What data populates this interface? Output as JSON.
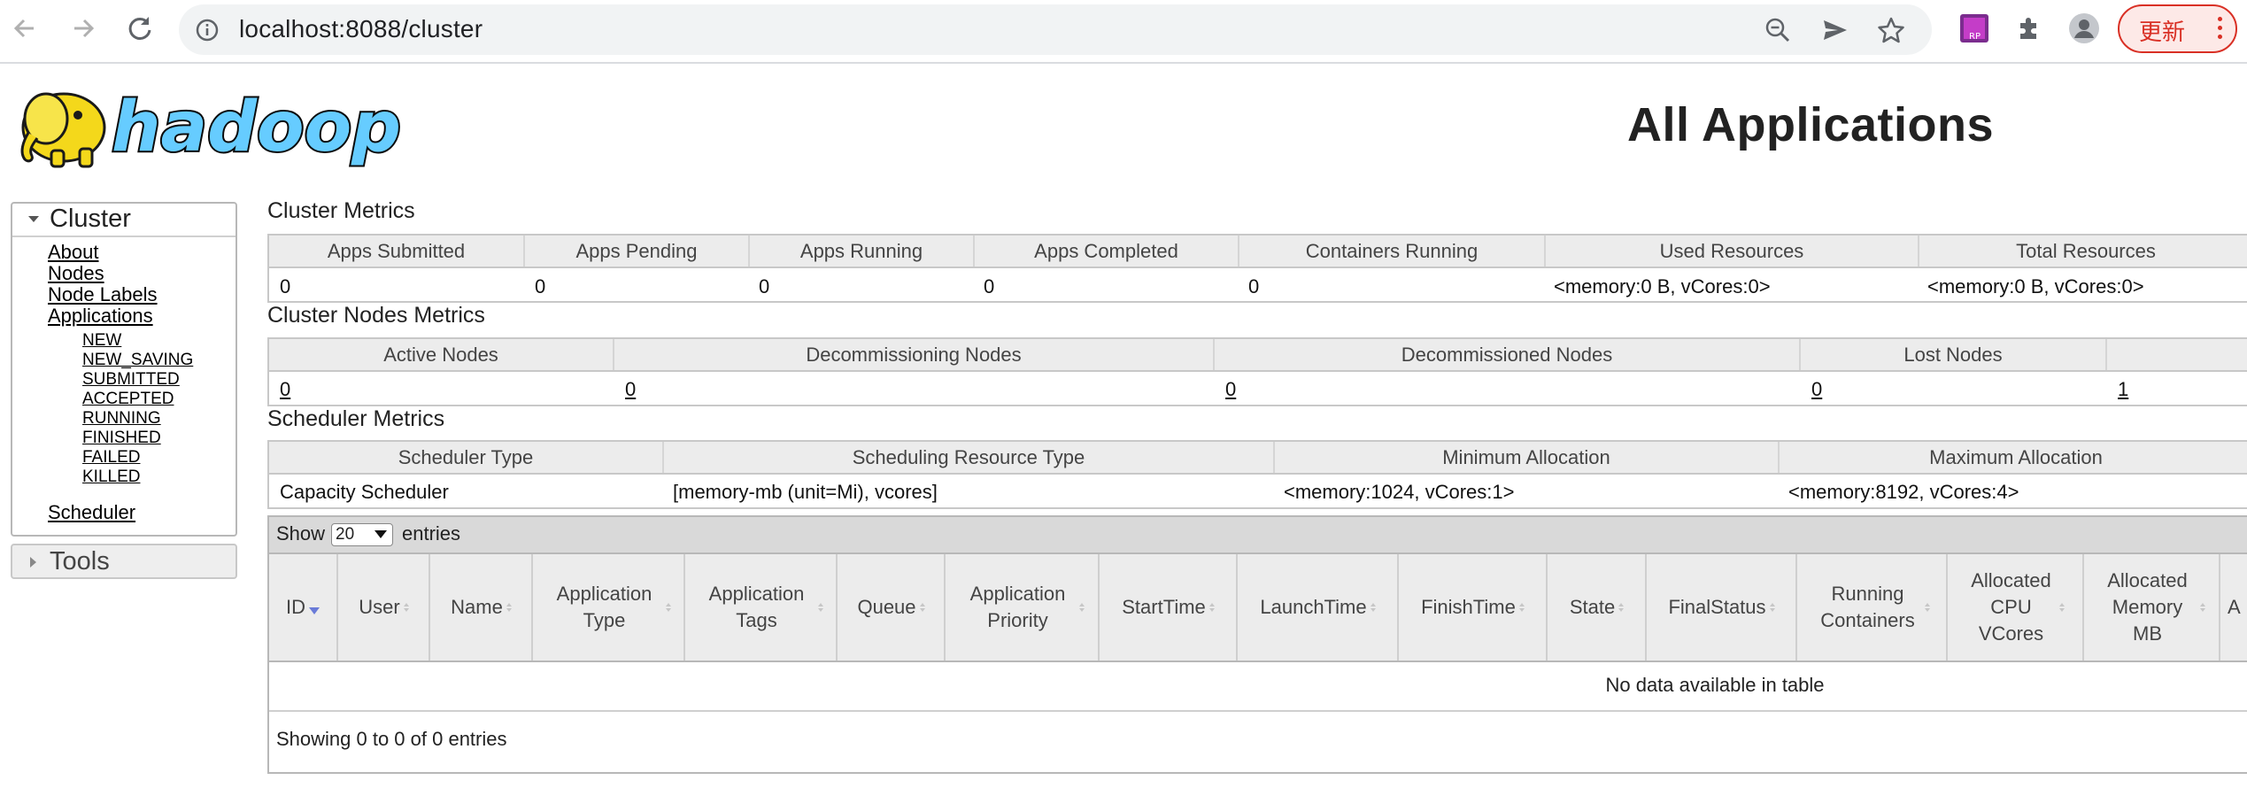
{
  "browser": {
    "url": "localhost:8088/cluster",
    "update_button": "更新",
    "icons": [
      "back-icon",
      "forward-icon",
      "reload-icon",
      "site-info-icon",
      "zoom-out-icon",
      "send-icon",
      "bookmark-star-icon",
      "extension-rp-icon",
      "puzzle-extension-icon",
      "profile-avatar-icon",
      "menu-kebab-icon"
    ],
    "ext_rp_label": "RP"
  },
  "header": {
    "logo_text": "hadoop",
    "title": "All Applications"
  },
  "nav": {
    "cluster_label": "Cluster",
    "links": [
      "About",
      "Nodes",
      "Node Labels",
      "Applications"
    ],
    "app_states": [
      "NEW",
      "NEW_SAVING",
      "SUBMITTED",
      "ACCEPTED",
      "RUNNING",
      "FINISHED",
      "FAILED",
      "KILLED"
    ],
    "scheduler": "Scheduler",
    "tools_label": "Tools"
  },
  "cluster_metrics": {
    "title": "Cluster Metrics",
    "headers": [
      "Apps Submitted",
      "Apps Pending",
      "Apps Running",
      "Apps Completed",
      "Containers Running",
      "Used Resources",
      "Total Resources"
    ],
    "values": [
      "0",
      "0",
      "0",
      "0",
      "0",
      "<memory:0 B, vCores:0>",
      "<memory:0 B, vCores:0>"
    ]
  },
  "nodes_metrics": {
    "title": "Cluster Nodes Metrics",
    "headers": [
      "Active Nodes",
      "Decommissioning Nodes",
      "Decommissioned Nodes",
      "Lost Nodes",
      ""
    ],
    "values": [
      "0",
      "0",
      "0",
      "0",
      "1"
    ]
  },
  "scheduler_metrics": {
    "title": "Scheduler Metrics",
    "headers": [
      "Scheduler Type",
      "Scheduling Resource Type",
      "Minimum Allocation",
      "Maximum Allocation"
    ],
    "values": [
      "Capacity Scheduler",
      "[memory-mb (unit=Mi), vcores]",
      "<memory:1024, vCores:1>",
      "<memory:8192, vCores:4>"
    ]
  },
  "apps_table": {
    "show_label": "Show",
    "page_size": "20",
    "entries_label": "entries",
    "columns": [
      {
        "label": "ID"
      },
      {
        "label": "User"
      },
      {
        "label": "Name"
      },
      {
        "label": "Application Type"
      },
      {
        "label": "Application Tags"
      },
      {
        "label": "Queue"
      },
      {
        "label": "Application Priority"
      },
      {
        "label": "StartTime"
      },
      {
        "label": "LaunchTime"
      },
      {
        "label": "FinishTime"
      },
      {
        "label": "State"
      },
      {
        "label": "FinalStatus"
      },
      {
        "label": "Running Containers"
      },
      {
        "label": "Allocated CPU VCores"
      },
      {
        "label": "Allocated Memory MB"
      },
      {
        "label": "A"
      }
    ],
    "empty_message": "No data available in table",
    "info": "Showing 0 to 0 of 0 entries"
  }
}
